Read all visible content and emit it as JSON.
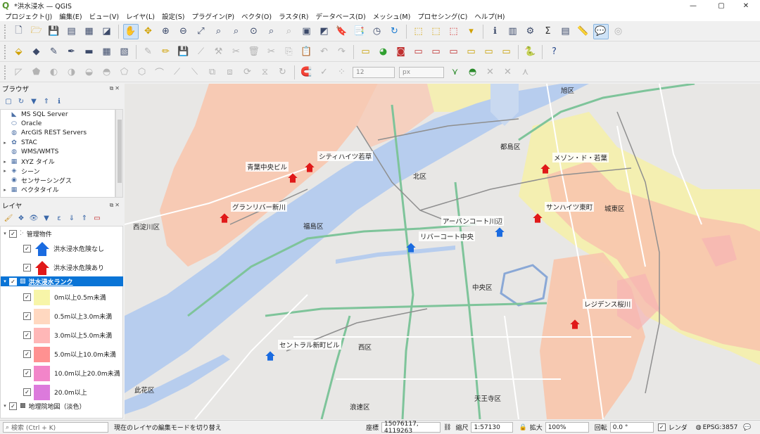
{
  "window": {
    "title": "*洪水浸水 — QGIS",
    "minimize": "—",
    "maximize": "▢",
    "close": "✕"
  },
  "menu": [
    "プロジェクト(J)",
    "編集(E)",
    "ビュー(V)",
    "レイヤ(L)",
    "設定(S)",
    "プラグイン(P)",
    "ベクタ(O)",
    "ラスタ(R)",
    "データベース(D)",
    "メッシュ(M)",
    "プロセシング(C)",
    "ヘルプ(H)"
  ],
  "toolbar": {
    "snap_tolerance": "12",
    "snap_unit": "px"
  },
  "browser": {
    "title": "ブラウザ",
    "items": [
      {
        "label": "MS SQL Server",
        "icon": "mssql-icon",
        "glyph": "◣",
        "arrow": ""
      },
      {
        "label": "Oracle",
        "icon": "oracle-icon",
        "glyph": "⬭",
        "arrow": ""
      },
      {
        "label": "ArcGIS REST Servers",
        "icon": "globe-icon",
        "glyph": "◍",
        "arrow": ""
      },
      {
        "label": "STAC",
        "icon": "stac-icon",
        "glyph": "✿",
        "arrow": "▸"
      },
      {
        "label": "WMS/WMTS",
        "icon": "globe-icon",
        "glyph": "◍",
        "arrow": ""
      },
      {
        "label": "XYZ タイル",
        "icon": "grid-icon",
        "glyph": "▦",
        "arrow": "▸"
      },
      {
        "label": "シーン",
        "icon": "scene-icon",
        "glyph": "◈",
        "arrow": "▸"
      },
      {
        "label": "センサーシングス",
        "icon": "sensor-icon",
        "glyph": "◉",
        "arrow": ""
      },
      {
        "label": "ベクタタイル",
        "icon": "grid-icon",
        "glyph": "▦",
        "arrow": "▸"
      }
    ]
  },
  "layers": {
    "title": "レイヤ",
    "group_properties": "管理物件",
    "legend_safe": "洪水浸水危険なし",
    "legend_risk": "洪水浸水危険あり",
    "flood_layer": "洪水浸水ランク",
    "ranks": [
      {
        "label": "0m以上0.5m未満",
        "color": "#f7f5a8"
      },
      {
        "label": "0.5m以上3.0m未満",
        "color": "#ffd8c0"
      },
      {
        "label": "3.0m以上5.0m未満",
        "color": "#ffb7b7"
      },
      {
        "label": "5.0m以上10.0m未満",
        "color": "#ff9191"
      },
      {
        "label": "10.0m以上20.0m未満",
        "color": "#f285c9"
      },
      {
        "label": "20.0m以上",
        "color": "#dc7adc"
      }
    ],
    "basemap": "地理院地図（淡色）"
  },
  "map": {
    "properties": [
      {
        "label": "シティハイツ若草",
        "risk": true
      },
      {
        "label": "青葉中央ビル",
        "risk": true
      },
      {
        "label": "グランリバー新川",
        "risk": true
      },
      {
        "label": "メゾン・ド・若葉",
        "risk": true
      },
      {
        "label": "サンハイツ東町",
        "risk": true
      },
      {
        "label": "アーバンコート川辺",
        "risk": false
      },
      {
        "label": "リバーコート中央",
        "risk": false
      },
      {
        "label": "セントラル新町ビル",
        "risk": false
      },
      {
        "label": "レジデンス桜川",
        "risk": true
      }
    ],
    "places": [
      "旭区",
      "都島区",
      "北区",
      "福島区",
      "西淀川区",
      "城東区",
      "中央区",
      "西区",
      "天王寺区",
      "浪速区",
      "此花区"
    ]
  },
  "status": {
    "search_placeholder": "検索 (Ctrl + K)",
    "message": "現在のレイヤの編集モードを切り替え",
    "coord_label": "座標",
    "coord_value": "15076117, 4119263",
    "scale_label": "縮尺",
    "scale_value": "1:57130",
    "magnifier_label": "拡大",
    "magnifier_value": "100%",
    "rotation_label": "回転",
    "rotation_value": "0.0 °",
    "render_label": "レンダ",
    "crs": "EPSG:3857"
  }
}
